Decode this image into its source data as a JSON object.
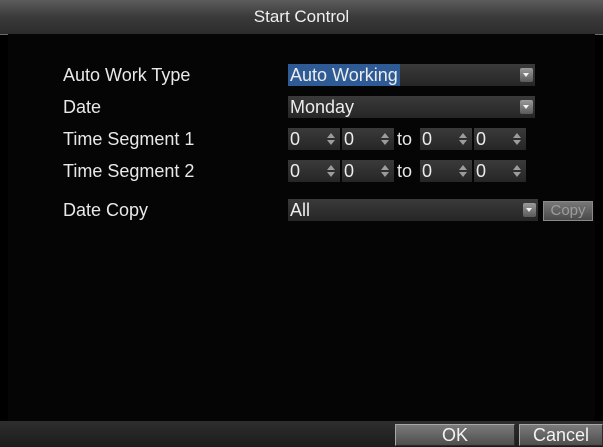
{
  "window": {
    "title": "Start Control"
  },
  "form": {
    "auto_work_type": {
      "label": "Auto Work Type",
      "value": "Auto Working"
    },
    "date": {
      "label": "Date",
      "value": "Monday"
    },
    "time_segment_1": {
      "label": "Time Segment 1",
      "start_hour": "0",
      "start_minute": "0",
      "separator": "to",
      "end_hour": "0",
      "end_minute": "0"
    },
    "time_segment_2": {
      "label": "Time Segment 2",
      "start_hour": "0",
      "start_minute": "0",
      "separator": "to",
      "end_hour": "0",
      "end_minute": "0"
    },
    "date_copy": {
      "label": "Date Copy",
      "value": "All",
      "copy_label": "Copy"
    }
  },
  "footer": {
    "ok_label": "OK",
    "cancel_label": "Cancel"
  },
  "colors": {
    "selection": "#2e5b95",
    "background": "#000000"
  }
}
